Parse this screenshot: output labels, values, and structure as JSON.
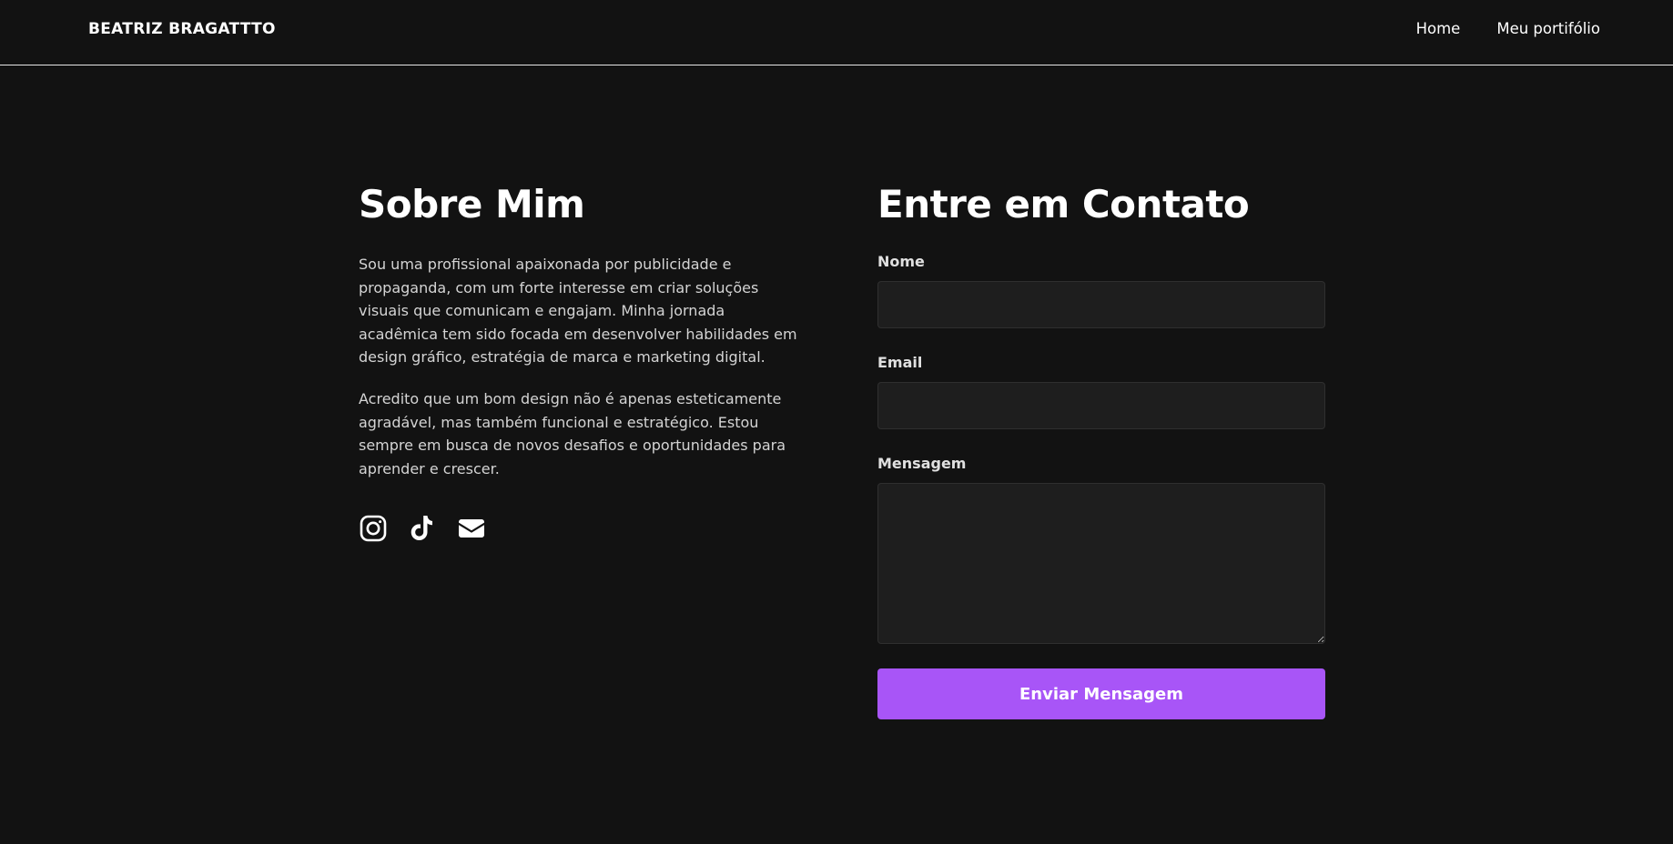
{
  "nav": {
    "brand": "BEATRIZ BRAGATTTO",
    "links": [
      {
        "label": "Home"
      },
      {
        "label": "Meu portifólio"
      }
    ]
  },
  "about": {
    "title": "Sobre Mim",
    "paragraphs": [
      "Sou uma profissional apaixonada por publicidade e propaganda, com um forte interesse em criar soluções visuais que comunicam e engajam. Minha jornada acadêmica tem sido focada em desenvolver habilidades em design gráfico, estratégia de marca e marketing digital.",
      "Acredito que um bom design não é apenas esteticamente agradável, mas também funcional e estratégico. Estou sempre em busca de novos desafios e oportunidades para aprender e crescer."
    ],
    "socials": [
      {
        "icon": "instagram-icon"
      },
      {
        "icon": "tiktok-icon"
      },
      {
        "icon": "email-icon"
      }
    ]
  },
  "contact": {
    "title": "Entre em Contato",
    "fields": {
      "name": {
        "label": "Nome",
        "value": "",
        "placeholder": ""
      },
      "email": {
        "label": "Email",
        "value": "",
        "placeholder": ""
      },
      "message": {
        "label": "Mensagem",
        "value": "",
        "placeholder": ""
      }
    },
    "submit_label": "Enviar Mensagem"
  },
  "colors": {
    "background": "#121212",
    "accent": "#a855f7",
    "input_bg": "#1e1e1e"
  }
}
